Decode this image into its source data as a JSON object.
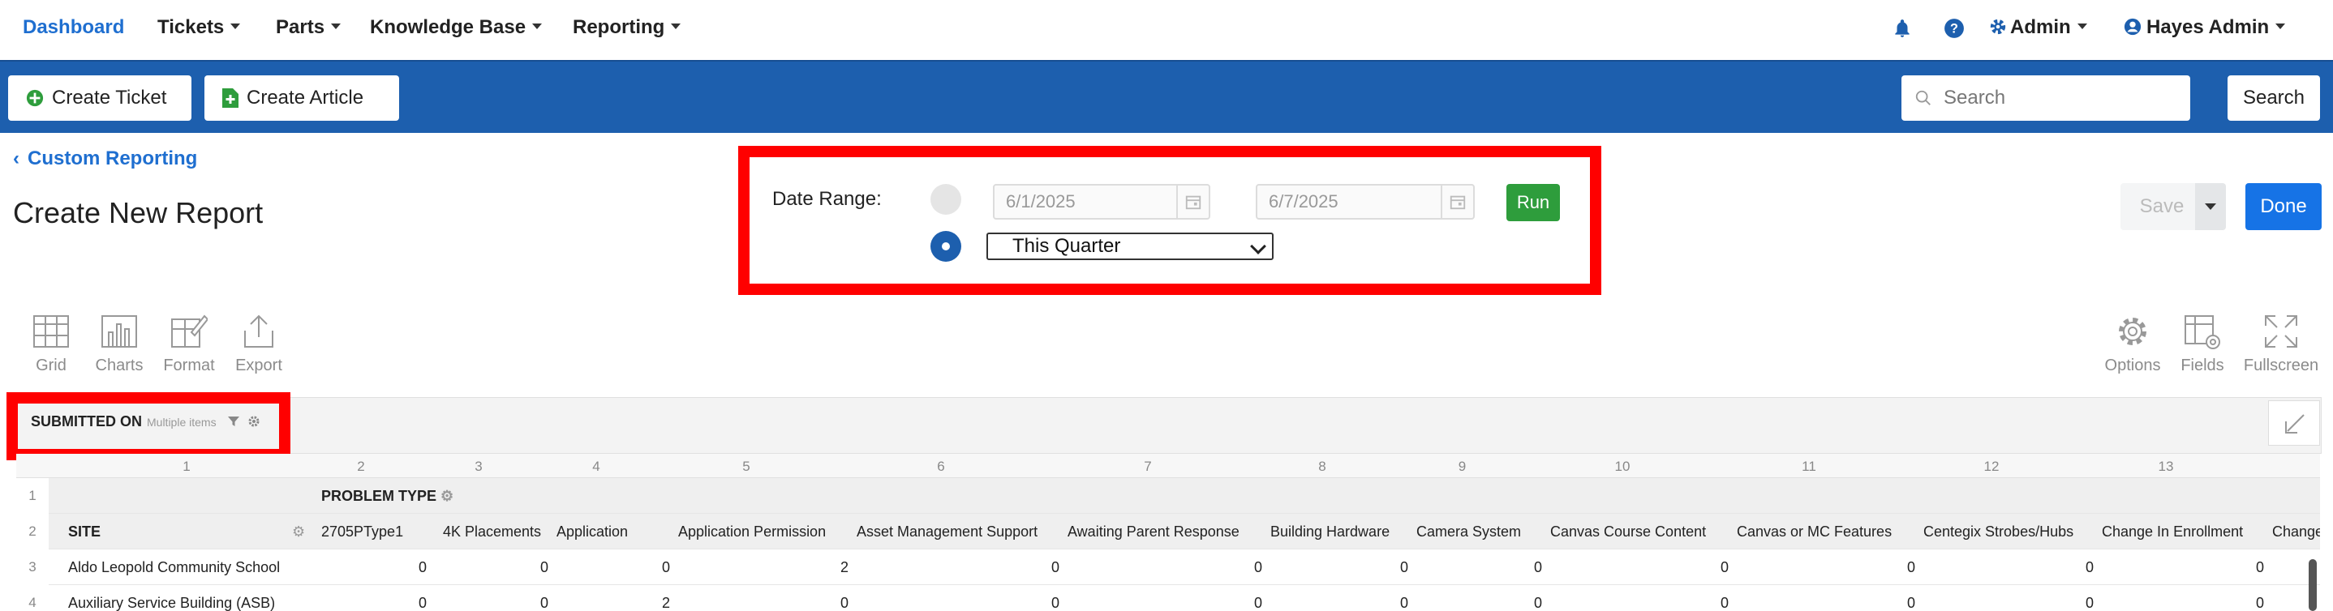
{
  "nav": {
    "dashboard": "Dashboard",
    "tickets": "Tickets",
    "parts": "Parts",
    "knowledge_base": "Knowledge Base",
    "reporting": "Reporting",
    "admin": "Admin",
    "user": "Hayes Admin"
  },
  "toolbar": {
    "create_ticket": "Create Ticket",
    "create_article": "Create Article",
    "search_placeholder": "Search",
    "search_button": "Search"
  },
  "page": {
    "back_link": "Custom Reporting",
    "title": "Create New Report",
    "save": "Save",
    "done": "Done"
  },
  "date_range": {
    "label": "Date Range:",
    "start": "6/1/2025",
    "end": "6/7/2025",
    "run": "Run",
    "selected_option": "This Quarter"
  },
  "pivot_tools": {
    "grid": "Grid",
    "charts": "Charts",
    "format": "Format",
    "export": "Export",
    "options": "Options",
    "fields": "Fields",
    "fullscreen": "Fullscreen"
  },
  "filter": {
    "name": "SUBMITTED ON",
    "sub": "Multiple items"
  },
  "grid": {
    "col_numbers": [
      "1",
      "2",
      "3",
      "4",
      "5",
      "6",
      "7",
      "8",
      "9",
      "10",
      "11",
      "12",
      "13"
    ],
    "row_numbers": [
      "1",
      "2",
      "3",
      "4"
    ],
    "problem_type_label": "PROBLEM TYPE",
    "site_label": "SITE",
    "columns": [
      "2705PType1",
      "4K Placements",
      "Application",
      "Application Permission",
      "Asset Management Support",
      "Awaiting Parent Response",
      "Building Hardware",
      "Camera System",
      "Canvas Course Content",
      "Canvas or MC Features",
      "Centegix Strobes/Hubs",
      "Change In Enrollment",
      "Change"
    ],
    "rows": [
      {
        "site": "Aldo Leopold Community School",
        "values": [
          "0",
          "0",
          "0",
          "2",
          "0",
          "0",
          "0",
          "0",
          "0",
          "0",
          "0",
          "0"
        ]
      },
      {
        "site": "Auxiliary Service Building (ASB)",
        "values": [
          "0",
          "0",
          "2",
          "0",
          "0",
          "0",
          "0",
          "0",
          "0",
          "0",
          "0",
          "0"
        ]
      }
    ]
  },
  "colors": {
    "brand_blue": "#1d5fae",
    "link_blue": "#1f6fd0",
    "highlight_red": "#ff0000",
    "run_green": "#2e9d3c",
    "done_blue": "#1673e6"
  }
}
